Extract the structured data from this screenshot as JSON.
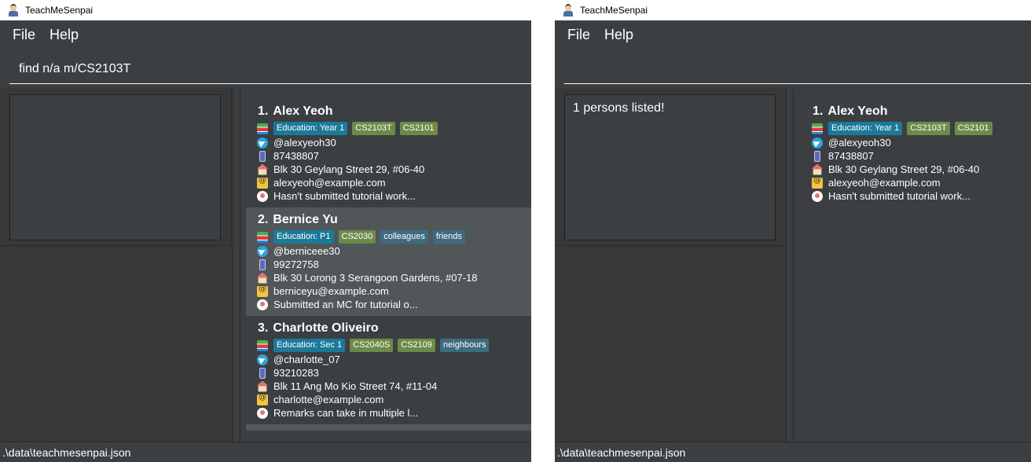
{
  "app": {
    "title": "TeachMeSenpai"
  },
  "menu": {
    "file": "File",
    "help": "Help"
  },
  "status": {
    "path": ".\\data\\teachmesenpai.json"
  },
  "left_window": {
    "command": {
      "value": "find n/a m/CS2103T",
      "placeholder": ""
    },
    "result": "",
    "persons": [
      {
        "index": "1.",
        "name": "Alex Yeoh",
        "education": "Education: Year 1",
        "modules": [
          "CS2103T",
          "CS2101"
        ],
        "tags": [],
        "telegram": "@alexyeoh30",
        "phone": "87438807",
        "address": "Blk 30 Geylang Street 29, #06-40",
        "email": "alexyeoh@example.com",
        "remark": "Hasn't submitted tutorial work..."
      },
      {
        "index": "2.",
        "name": "Bernice Yu",
        "education": "Education: P1",
        "modules": [
          "CS2030"
        ],
        "tags": [
          "colleagues",
          "friends"
        ],
        "telegram": "@berniceee30",
        "phone": "99272758",
        "address": "Blk 30 Lorong 3 Serangoon Gardens, #07-18",
        "email": "berniceyu@example.com",
        "remark": "Submitted an MC for tutorial o..."
      },
      {
        "index": "3.",
        "name": "Charlotte Oliveiro",
        "education": "Education: Sec 1",
        "modules": [
          "CS2040S",
          "CS2109"
        ],
        "tags": [
          "neighbours"
        ],
        "telegram": "@charlotte_07",
        "phone": "93210283",
        "address": "Blk 11 Ang Mo Kio Street 74, #11-04",
        "email": "charlotte@example.com",
        "remark": "Remarks can take in multiple l..."
      }
    ]
  },
  "right_window": {
    "command": {
      "value": "",
      "placeholder": ""
    },
    "result": "1 persons listed!",
    "persons": [
      {
        "index": "1.",
        "name": "Alex Yeoh",
        "education": "Education: Year 1",
        "modules": [
          "CS2103T",
          "CS2101"
        ],
        "tags": [],
        "telegram": "@alexyeoh30",
        "phone": "87438807",
        "address": "Blk 30 Geylang Street 29, #06-40",
        "email": "alexyeoh@example.com",
        "remark": "Hasn't submitted tutorial work..."
      }
    ]
  }
}
